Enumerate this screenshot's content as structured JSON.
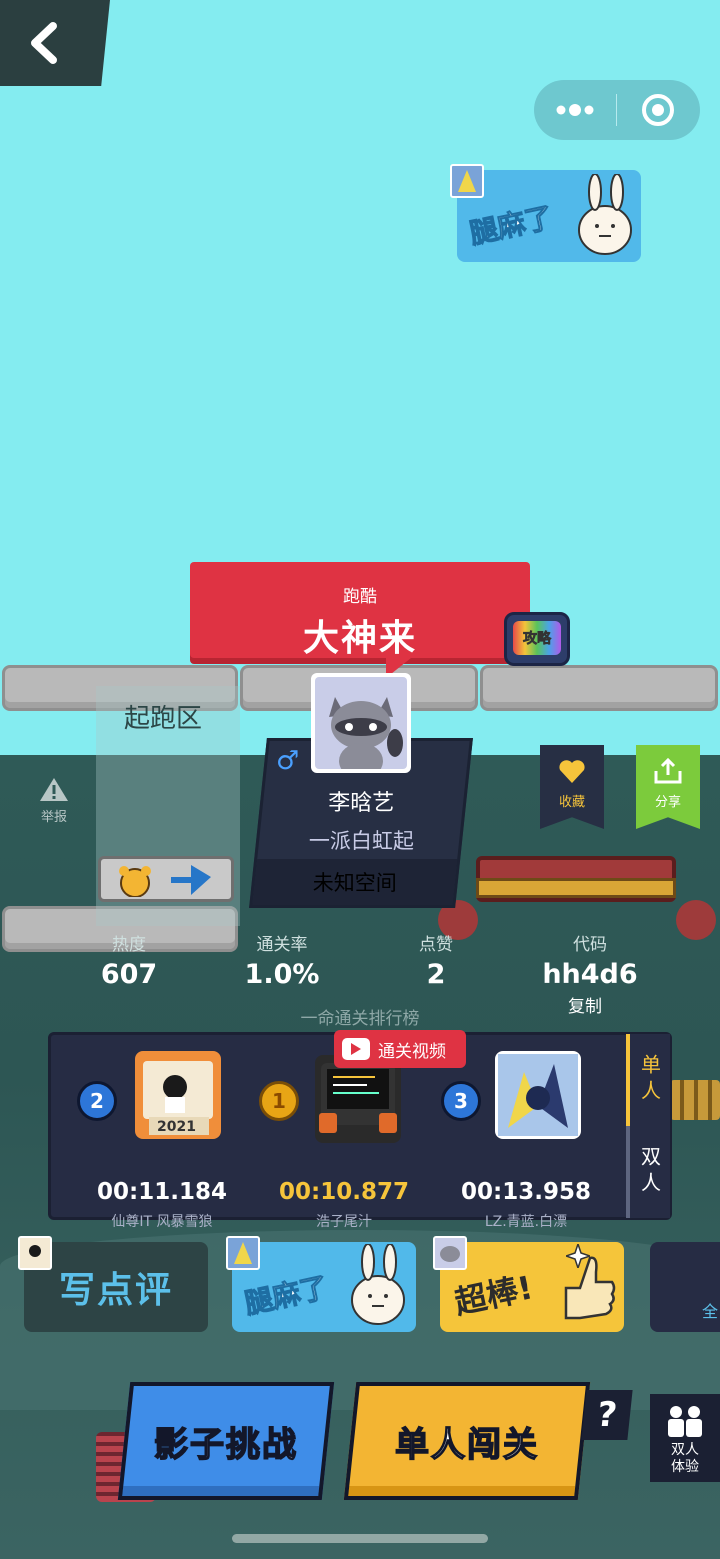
{
  "nav": {
    "back_icon": "chevron-left-icon"
  },
  "capsule": {
    "menu_icon": "more-dots-icon",
    "close_icon": "target-circle-icon"
  },
  "top_sticker": {
    "text": "腿麻了"
  },
  "banner": {
    "subtitle": "跑酷",
    "title": "大神来"
  },
  "guide_tv": {
    "label": "攻略"
  },
  "start_zone": {
    "label": "起跑区"
  },
  "level": {
    "gender": "♂",
    "author": "李晗艺",
    "title": "一派白虹起",
    "space": "未知空间"
  },
  "actions": {
    "favorite": "收藏",
    "share": "分享",
    "report": "举报"
  },
  "stats": [
    {
      "label": "热度",
      "value": "607"
    },
    {
      "label": "通关率",
      "value": "1.0%"
    },
    {
      "label": "点赞",
      "value": "2"
    },
    {
      "label": "代码",
      "value": "hh4d6"
    }
  ],
  "copy_label": "复制",
  "leaderboard": {
    "title": "一命通关排行榜",
    "video_label": "通关视频",
    "players": [
      {
        "rank": "2",
        "time": "00:11.184",
        "name": "仙尊IT 风暴雪狼"
      },
      {
        "rank": "1",
        "time": "00:10.877",
        "name": "浩子尾汁"
      },
      {
        "rank": "3",
        "time": "00:13.958",
        "name": "LZ.青蓝.白漂"
      }
    ],
    "tabs": [
      "单人",
      "双人"
    ]
  },
  "comments": {
    "write": "写点评",
    "stickers": [
      "腿麻了",
      "超棒!"
    ],
    "more": "全"
  },
  "buttons": {
    "shadow": "影子挑战",
    "solo": "单人闯关",
    "help": "?",
    "duo": "双人\n体验"
  },
  "colors": {
    "sky": "#84ecf0",
    "banner_red": "#df3343",
    "gold": "#f6c43b",
    "blue_btn": "#3f8de8",
    "yellow_btn": "#f3b533"
  }
}
